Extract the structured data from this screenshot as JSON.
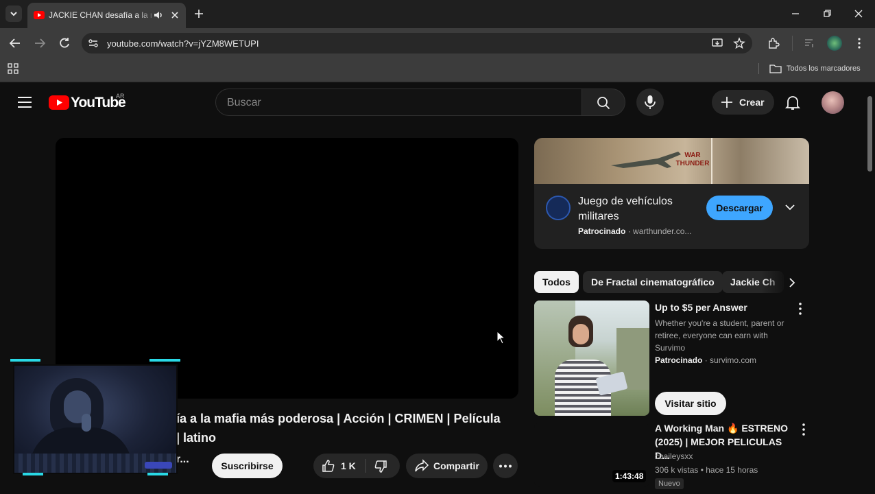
{
  "browser": {
    "tab_title": "JACKIE CHAN desafía a la mafia",
    "url": "youtube.com/watch?v=jYZM8WETUPI",
    "bookmarks_label": "Todos los marcadores"
  },
  "youtube": {
    "logo_text": "YouTube",
    "country_code": "AR",
    "search_placeholder": "Buscar",
    "create_label": "Crear"
  },
  "video": {
    "title_lines": [
      "ía a la mafia más poderosa | Acción | CRIMEN | Película",
      "| latino"
    ],
    "channel_fragment": "r...",
    "subscribe_label": "Suscribirse",
    "likes": "1 K",
    "share_label": "Compartir"
  },
  "ad": {
    "banner_text": "WAR THUNDER",
    "title": "Juego de vehículos militares",
    "sponsored_label": "Patrocinado",
    "domain": "warthunder.co...",
    "download_label": "Descargar"
  },
  "chips": [
    "Todos",
    "De Fractal cinematográfico",
    "Jackie Ch"
  ],
  "recommendations": [
    {
      "title": "Up to $5 per Answer",
      "description": "Whether you're a student, parent or retiree, everyone can earn with Survimo",
      "sponsored_label": "Patrocinado",
      "domain": "survimo.com",
      "cta_label": "Visitar sitio"
    },
    {
      "title": "A Working Man 🔥 ESTRENO (2025) | MEJOR PELICULAS D...",
      "channel": "cbaileysxx",
      "stats": "306 k vistas • hace 15 horas",
      "duration": "1:43:48",
      "badge": "Nuevo"
    }
  ],
  "colors": {
    "youtube_red": "#ff0000",
    "accent_blue": "#3ea6ff",
    "background": "#0f0f0f"
  }
}
